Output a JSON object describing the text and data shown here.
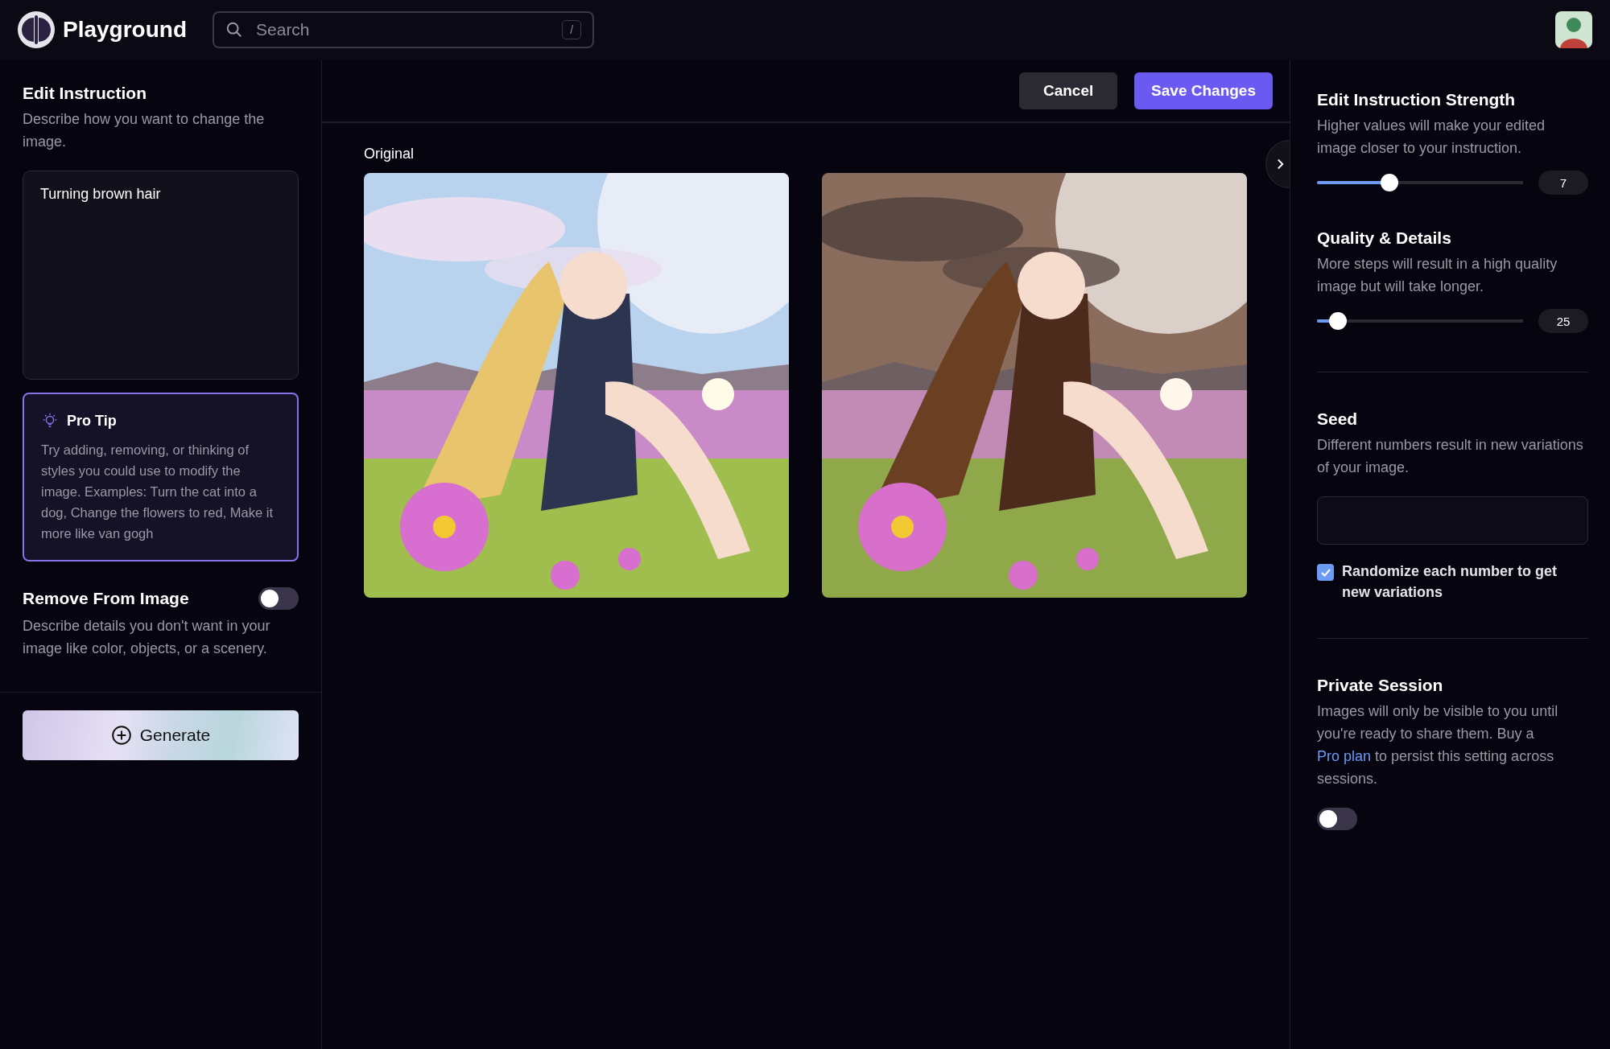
{
  "header": {
    "brand": "Playground",
    "search": {
      "placeholder": "Search",
      "shortcut": "/"
    }
  },
  "left": {
    "instruction": {
      "title": "Edit Instruction",
      "description": "Describe how you want to change the image.",
      "value": "Turning brown hair"
    },
    "pro_tip": {
      "title": "Pro Tip",
      "text": "Try adding, removing, or thinking of styles you could use to modify the image. Examples: Turn the cat into a dog, Change the flowers to red, Make it more like van gogh"
    },
    "remove": {
      "title": "Remove From Image",
      "on": false,
      "description": "Describe details you don't want in your image like color, objects, or a scenery."
    },
    "generate": "Generate"
  },
  "toolbar": {
    "buttons": [
      {
        "label": "Cancel",
        "kind": "secondary"
      },
      {
        "label": "Save Changes",
        "kind": "primary"
      }
    ]
  },
  "images": [
    {
      "label": "Original",
      "kind": "picture"
    },
    {
      "kind": "picture"
    }
  ],
  "right": {
    "sliders": [
      {
        "title": "Edit Instruction Strength",
        "description": "Higher values will make your edited image closer to your instruction.",
        "level": 0.35,
        "reading": "7"
      },
      {
        "title": "Quality & Details",
        "description": "More steps will result in a high quality image but will take longer.",
        "level": 0.1,
        "reading": "25"
      }
    ],
    "seed": {
      "title": "Seed",
      "description": "Different numbers result in new variations of your image.",
      "randomize": {
        "label": "Randomize each number to get new variations",
        "checked": true
      }
    },
    "private": {
      "title": "Private Session",
      "text_before": "Images will only be visible to you until you're ready to share them. Buy a ",
      "link": "Pro plan",
      "text_after": " to persist this setting across sessions.",
      "on": false
    }
  }
}
